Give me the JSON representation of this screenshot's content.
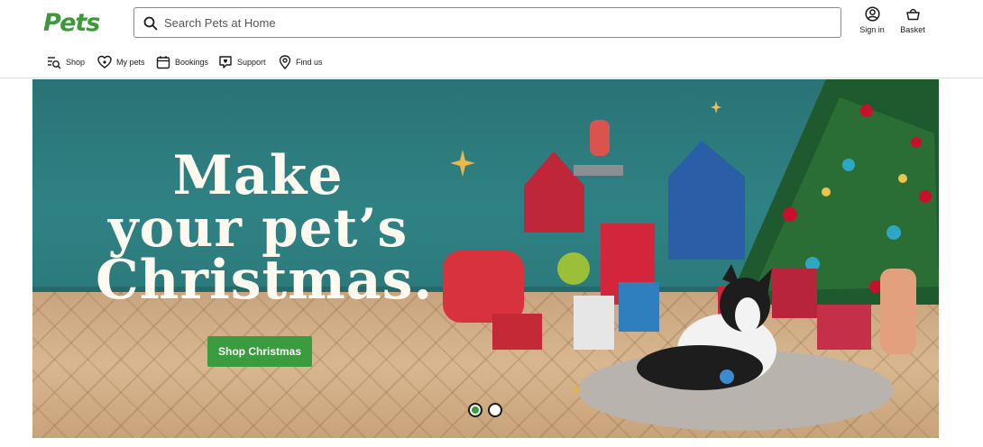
{
  "header": {
    "logo_text": "Pets",
    "search_placeholder": "Search Pets at Home",
    "sign_in_label": "Sign in",
    "basket_label": "Basket"
  },
  "nav": {
    "items": [
      {
        "label": "Shop",
        "icon": "shop-search-icon"
      },
      {
        "label": "My pets",
        "icon": "heart-paw-icon"
      },
      {
        "label": "Bookings",
        "icon": "calendar-icon"
      },
      {
        "label": "Support",
        "icon": "chat-heart-icon"
      },
      {
        "label": "Find us",
        "icon": "location-pin-icon"
      }
    ]
  },
  "hero": {
    "headline_line1": "Make",
    "headline_line2": "your pet’s",
    "headline_line3": "Christmas.",
    "cta_label": "Shop Christmas",
    "carousel": {
      "slides": 2,
      "active": 1
    }
  },
  "colors": {
    "brand_green": "#3d9a3a",
    "hero_wall": "#2f7e7f",
    "headline": "#fffaf0"
  }
}
